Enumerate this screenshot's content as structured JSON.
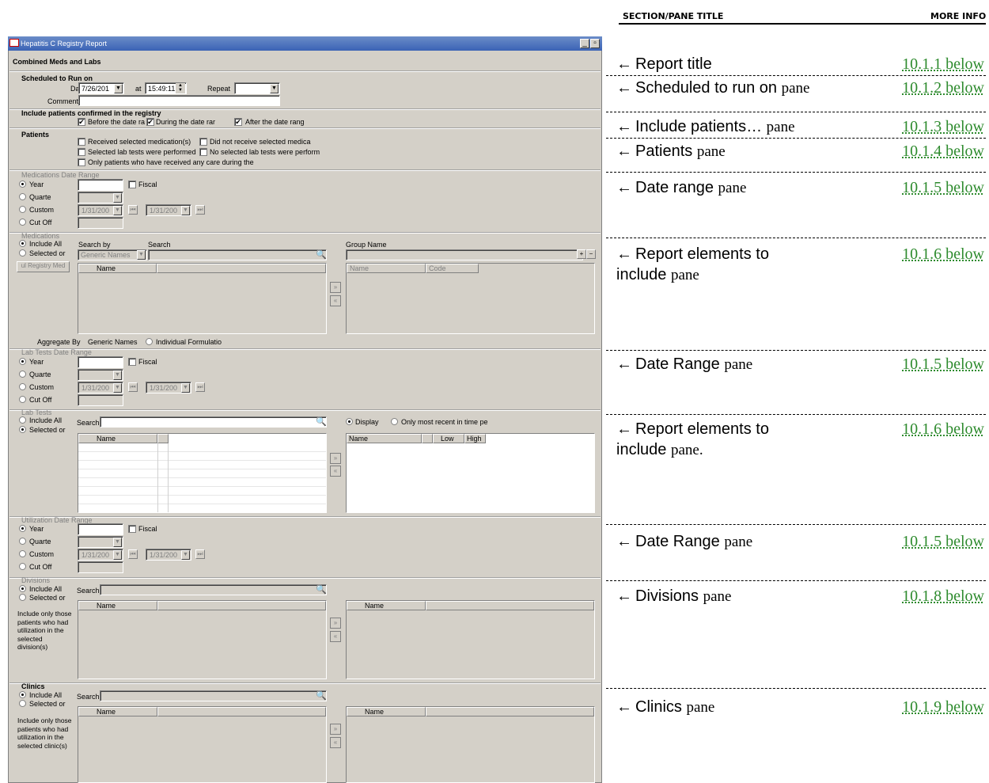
{
  "annotations": {
    "col_section": "SECTION/PANE TITLE",
    "col_more": "MORE INFO",
    "arrow": "←",
    "rows": [
      {
        "title": "Report title",
        "suffix": "",
        "link": "10.1.1 below"
      },
      {
        "title": "Scheduled to run on",
        "suffix": "pane",
        "link": "10.1.2 below"
      },
      {
        "title": "Include patients…",
        "suffix": "pane",
        "link": "10.1.3 below"
      },
      {
        "title": "Patients",
        "suffix": "pane",
        "link": "10.1.4 below"
      },
      {
        "title": "Date range",
        "suffix": "pane",
        "link": "10.1.5 below"
      },
      {
        "title": "Report elements to include",
        "suffix": "pane",
        "link": "10.1.6 below"
      },
      {
        "title": "Date Range",
        "suffix": "pane",
        "link": "10.1.5 below"
      },
      {
        "title": "Report elements to include",
        "suffix": "pane.",
        "link": "10.1.6 below"
      },
      {
        "title": "Date Range",
        "suffix": "pane",
        "link": "10.1.5 below"
      },
      {
        "title": "Divisions",
        "suffix": "pane",
        "link": "10.1.8 below"
      },
      {
        "title": "Clinics",
        "suffix": "pane",
        "link": "10.1.9 below"
      }
    ]
  },
  "window": {
    "title": "Hepatitis C Registry Report",
    "report_title": "Combined Meds and Labs",
    "schedule": {
      "header": "Scheduled to Run on",
      "day_label": "Day",
      "day_value": "7/26/201",
      "at_label": "at",
      "time_value": "15:49:11",
      "repeat_label": "Repeat",
      "repeat_value": "",
      "comment_label": "Comment",
      "comment_value": ""
    },
    "include": {
      "header": "Include patients confirmed in the registry",
      "before": "Before the date ra",
      "during": "During the date rar",
      "after": "After the date rang"
    },
    "patients": {
      "header": "Patients",
      "opt1": "Received selected medication(s)",
      "opt2": "Did not receive selected medica",
      "opt3": "Selected lab tests were performed",
      "opt4": "No selected lab tests were perform",
      "opt5": "Only patients who have received any care during the"
    },
    "date_range": {
      "year": "Year",
      "quarter": "Quarte",
      "custom": "Custom",
      "cutoff": "Cut Off",
      "fiscal": "Fiscal",
      "from": "1/31/200",
      "to": "1/31/200",
      "first_icon": "⏮",
      "last_icon": "⏭"
    },
    "med_range_header": "Medications Date Range",
    "lab_range_header": "Lab Tests Date Range",
    "util_range_header": "Utilization Date Range",
    "medications": {
      "header": "Medications",
      "include_all": "Include All",
      "selected": "Selected or",
      "search_by_label": "Search by",
      "search_label": "Search",
      "search_by_value": "Generic Names",
      "group_name_label": "Group Name",
      "registry_btn": "ul Registry Med",
      "col_name": "Name",
      "col_code": "Code",
      "aggregate_label": "Aggregate By",
      "agg_generic": "Generic Names",
      "agg_individual": "Individual Formulatio"
    },
    "lab_tests": {
      "header": "Lab Tests",
      "include_all": "Include All",
      "selected": "Selected or",
      "search_label": "Search",
      "col_name": "Name",
      "display": "Display",
      "only_recent": "Only most recent in time pe",
      "col_low": "Low",
      "col_high": "High"
    },
    "divisions": {
      "header": "Divisions",
      "include_all": "Include All",
      "selected": "Selected or",
      "search_label": "Search",
      "col_name": "Name",
      "note": "Include only those patients who had utilization in the selected division(s)"
    },
    "clinics": {
      "header": "Clinics",
      "include_all": "Include All",
      "selected": "Selected or",
      "search_label": "Search",
      "col_name": "Name",
      "note": "Include only those patients who had utilization in the selected clinic(s)"
    }
  }
}
